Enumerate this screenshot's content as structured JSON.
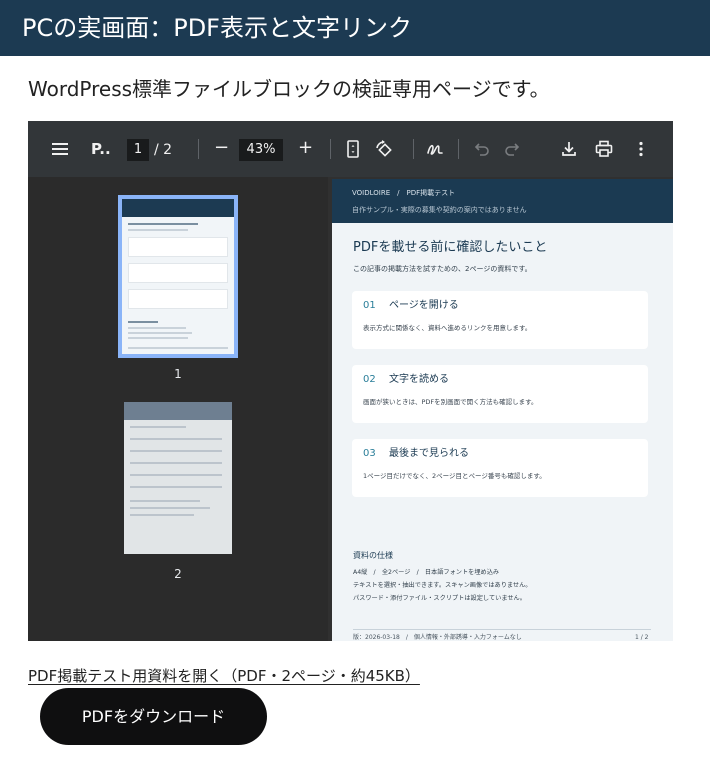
{
  "header": {
    "title": "PCの実画面：PDF表示と文字リンク"
  },
  "intro": {
    "text": "WordPress標準ファイルブロックの検証専用ページです。"
  },
  "viewer": {
    "toolbar": {
      "doc_name": "P..",
      "page_current": "1",
      "page_total": "/ 2",
      "zoom": "43%",
      "zoom_out": "−",
      "zoom_in": "+"
    },
    "thumbnails": [
      {
        "label": "1",
        "selected": true
      },
      {
        "label": "2",
        "selected": false
      }
    ],
    "page": {
      "breadcrumb": "VOIDLOIRE　/　PDF掲載テスト",
      "note": "自作サンプル・実際の募集や契約の案内ではありません",
      "title": "PDFを載せる前に確認したいこと",
      "subtitle": "この記事の掲載方法を試すための、2ページの資料です。",
      "cards": [
        {
          "num": "01",
          "title": "ページを開ける",
          "text": "表示方式に関係なく、資料へ進めるリンクを用意します。"
        },
        {
          "num": "02",
          "title": "文字を読める",
          "text": "画面が狭いときは、PDFを別画面で開く方法も確認します。"
        },
        {
          "num": "03",
          "title": "最後まで見られる",
          "text": "1ページ目だけでなく、2ページ目とページ番号も確認します。"
        }
      ],
      "spec_title": "資料の仕様",
      "spec_lines": [
        "A4縦　/　全2ページ　/　日本語フォントを埋め込み",
        "テキストを選択・抽出できます。スキャン画像ではありません。",
        "パスワード・添付ファイル・スクリプトは設定していません。"
      ],
      "footer_left": "版：2026-03-18　/　個人情報・外部誘導・入力フォームなし",
      "footer_right": "1 / 2"
    }
  },
  "file_link": {
    "text": "PDF掲載テスト用資料を開く（PDF・2ページ・約45KB）"
  },
  "download_button": {
    "label": "PDFをダウンロード"
  },
  "colors": {
    "header": "#1c3a52",
    "toolbar": "#323639",
    "accent": "#2a7e99",
    "button": "#0f0f10"
  }
}
